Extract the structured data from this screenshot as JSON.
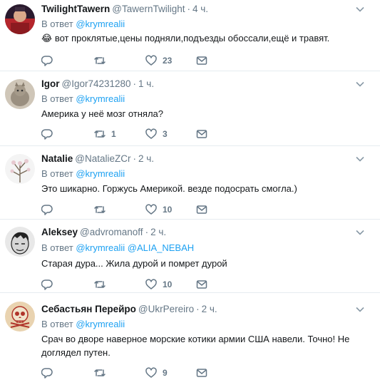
{
  "tweets": [
    {
      "name": "TwilightTawern",
      "handle": "@TawernTwilight",
      "time": "4 ч.",
      "reply_prefix": "В ответ",
      "reply_to": [
        "@krymrealii"
      ],
      "emoji": "😂",
      "text": "вот проклятые,цены подняли,подъезды обоссали,ещё и травят.",
      "counts": {
        "reply": "",
        "retweet": "",
        "like": "23"
      },
      "avatar_color": "#b5262c"
    },
    {
      "name": "Igor",
      "handle": "@Igor74231280",
      "time": "1 ч.",
      "reply_prefix": "В ответ",
      "reply_to": [
        "@krymrealii"
      ],
      "emoji": "",
      "text": "Америка у неё мозг отняла?",
      "counts": {
        "reply": "",
        "retweet": "1",
        "like": "3"
      },
      "avatar_color": "#9a8f80"
    },
    {
      "name": "Natalie",
      "handle": "@NatalieZCr",
      "time": "2 ч.",
      "reply_prefix": "В ответ",
      "reply_to": [
        "@krymrealii"
      ],
      "emoji": "",
      "text": "Это шикарно. Горжусь Америкой. везде подосрать смогла.)",
      "counts": {
        "reply": "",
        "retweet": "",
        "like": "10"
      },
      "avatar_color": "#f2f2f2"
    },
    {
      "name": "Aleksey",
      "handle": "@advromanoff",
      "time": "2 ч.",
      "reply_prefix": "В ответ",
      "reply_to": [
        "@krymrealii",
        "@ALIA_NEBAH"
      ],
      "emoji": "",
      "text": "Старая дура... Жила дурой и помрет дурой",
      "counts": {
        "reply": "",
        "retweet": "",
        "like": "10"
      },
      "avatar_color": "#555555"
    },
    {
      "name": "Себастьян Перейро",
      "handle": "@UkrPereiro",
      "time": "2 ч.",
      "reply_prefix": "В ответ",
      "reply_to": [
        "@krymrealii"
      ],
      "emoji": "",
      "text": "Срач во дворе наверное морские котики армии США навели. Точно! Не доглядел путен.",
      "counts": {
        "reply": "",
        "retweet": "",
        "like": "9"
      },
      "avatar_color": "#c9a57a"
    }
  ],
  "icons": {
    "reply": "reply-icon",
    "retweet": "retweet-icon",
    "like": "heart-icon",
    "message": "direct-message-icon",
    "more": "chevron-down-icon"
  },
  "colors": {
    "muted": "#657786",
    "link": "#1da1f2",
    "text": "#14171a",
    "divider": "#e6ecf0"
  }
}
